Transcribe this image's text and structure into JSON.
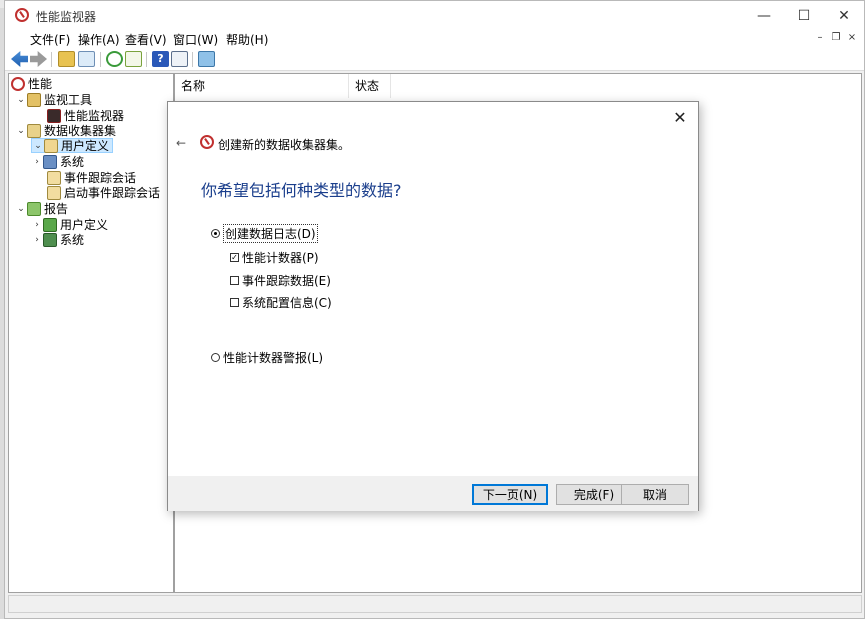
{
  "window": {
    "title": "性能监视器",
    "controls": [
      "minimize-icon",
      "maximize-icon",
      "close-icon"
    ]
  },
  "menu": [
    "文件(F)",
    "操作(A)",
    "查看(V)",
    "窗口(W)",
    "帮助(H)"
  ],
  "toolbar": [
    "back-icon",
    "forward-icon",
    "folder-up-icon",
    "show-hide-tree-icon",
    "refresh-icon",
    "export-icon",
    "help-icon",
    "properties-icon",
    "new-window-icon"
  ],
  "tree": [
    {
      "label": "性能",
      "level": 0
    },
    {
      "label": "监视工具",
      "level": 1
    },
    {
      "label": "性能监视器",
      "level": 2
    },
    {
      "label": "数据收集器集",
      "level": 1
    },
    {
      "label": "用户定义",
      "level": 2,
      "selected": true
    },
    {
      "label": "系统",
      "level": 2
    },
    {
      "label": "事件跟踪会话",
      "level": 2
    },
    {
      "label": "启动事件跟踪会话",
      "level": 2
    },
    {
      "label": "报告",
      "level": 1
    },
    {
      "label": "用户定义",
      "level": 2
    },
    {
      "label": "系统",
      "level": 2
    }
  ],
  "list": {
    "columns": [
      "名称",
      "状态"
    ]
  },
  "wizard": {
    "header": "创建新的数据收集器集。",
    "question": "你希望包括何种类型的数据?",
    "option_log": "创建数据日志(D)",
    "checks": [
      {
        "label": "性能计数器(P)",
        "checked": true
      },
      {
        "label": "事件跟踪数据(E)",
        "checked": false
      },
      {
        "label": "系统配置信息(C)",
        "checked": false
      }
    ],
    "option_alert": "性能计数器警报(L)",
    "buttons": {
      "next": "下一页(N)",
      "finish": "完成(F)",
      "cancel": "取消"
    }
  },
  "colors": {
    "accent": "#0078d7",
    "question": "#1a3e8c",
    "selection": "#cce8ff"
  }
}
